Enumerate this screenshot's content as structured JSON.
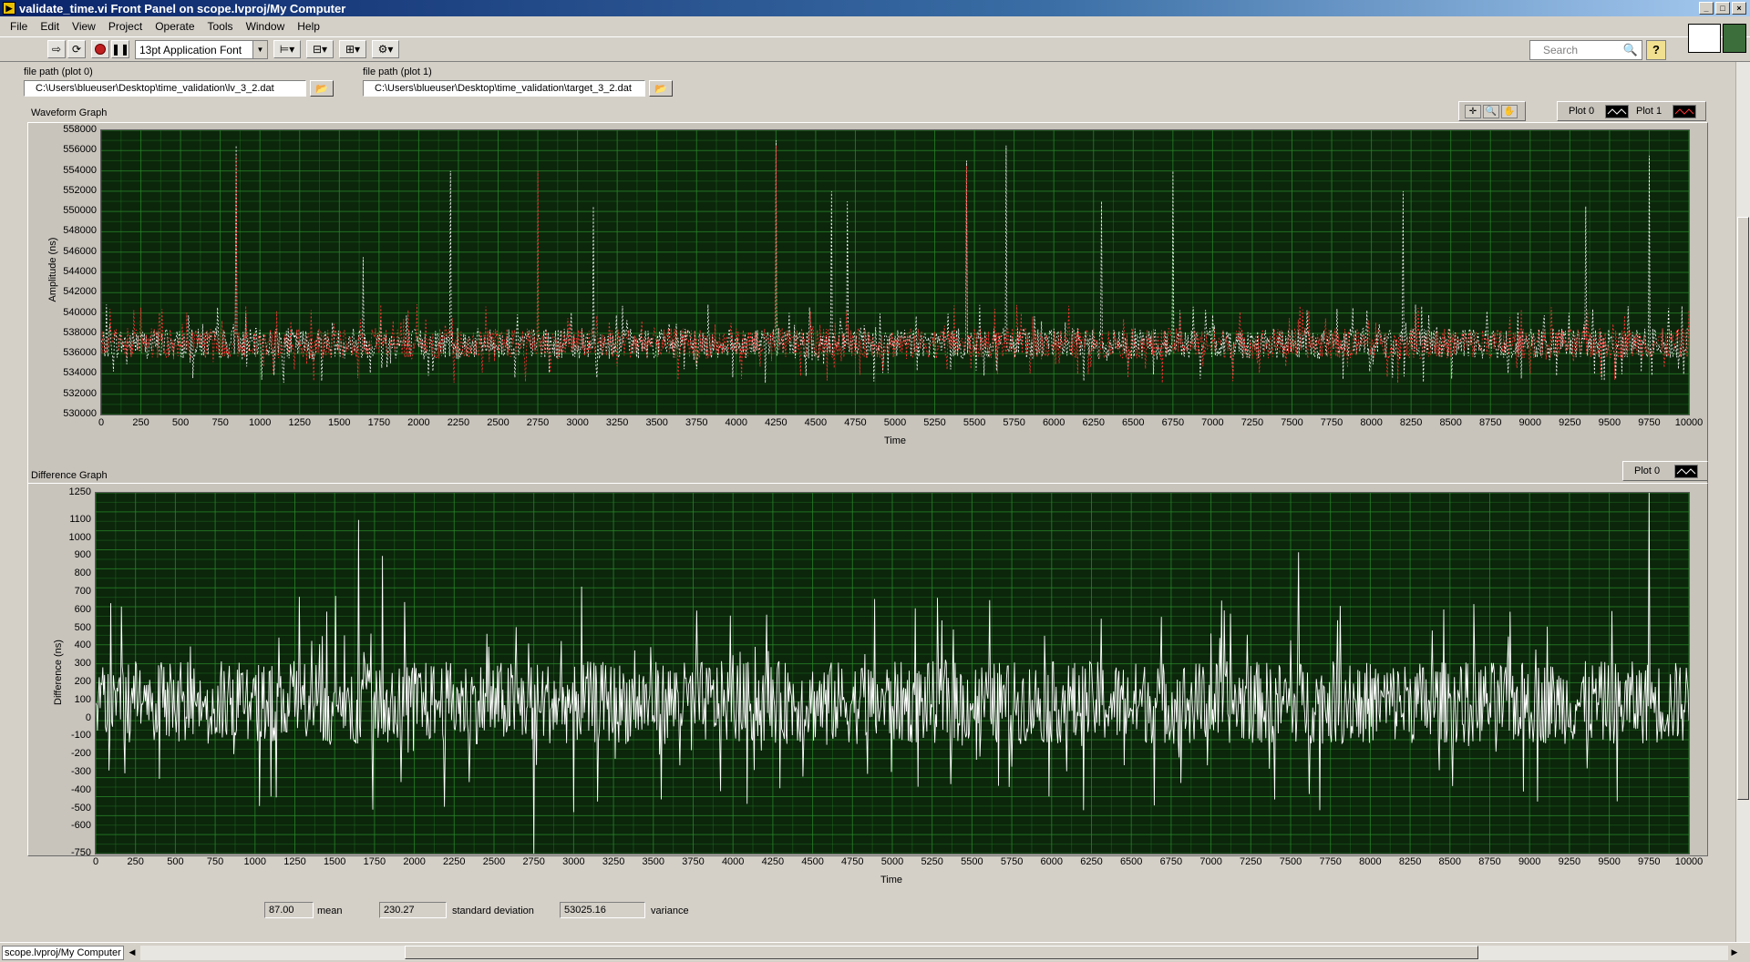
{
  "window": {
    "title": "validate_time.vi Front Panel on scope.lvproj/My Computer"
  },
  "menu": [
    "File",
    "Edit",
    "View",
    "Project",
    "Operate",
    "Tools",
    "Window",
    "Help"
  ],
  "toolbar": {
    "font": "13pt Application Font",
    "search_placeholder": "Search",
    "help_label": "?"
  },
  "file_path_0": {
    "label": "file path (plot 0)",
    "value": "C:\\Users\\blueuser\\Desktop\\time_validation\\lv_3_2.dat"
  },
  "file_path_1": {
    "label": "file path (plot 1)",
    "value": "C:\\Users\\blueuser\\Desktop\\time_validation\\target_3_2.dat"
  },
  "waveform": {
    "label": "Waveform Graph",
    "legend": [
      "Plot 0",
      "Plot 1"
    ],
    "plot0_color": "#ffffff",
    "plot1_color": "#ff3333",
    "grid_color": "#2b8a2b",
    "background": "#0b260b"
  },
  "difference": {
    "label": "Difference Graph",
    "legend": [
      "Plot 0"
    ],
    "plot0_color": "#ffffff"
  },
  "chart_data": [
    {
      "type": "line",
      "title": "Waveform Graph",
      "xlabel": "Time",
      "ylabel": "Amplitude (ns)",
      "xlim": [
        0,
        10000
      ],
      "ylim": [
        530000,
        558000
      ],
      "x_ticks": [
        0,
        250,
        500,
        750,
        1000,
        1250,
        1500,
        1750,
        2000,
        2250,
        2500,
        2750,
        3000,
        3250,
        3500,
        3750,
        4000,
        4250,
        4500,
        4750,
        5000,
        5250,
        5500,
        5750,
        6000,
        6250,
        6500,
        6750,
        7000,
        7250,
        7500,
        7750,
        8000,
        8250,
        8500,
        8750,
        9000,
        9250,
        9500,
        9750,
        10000
      ],
      "y_ticks": [
        530000,
        532000,
        534000,
        536000,
        538000,
        540000,
        542000,
        544000,
        546000,
        548000,
        550000,
        552000,
        554000,
        556000,
        558000
      ],
      "series": [
        {
          "name": "Plot 0",
          "baseline": 537000,
          "spread": 1500,
          "spikes": [
            [
              850,
              556500
            ],
            [
              1650,
              545500
            ],
            [
              2200,
              554000
            ],
            [
              3100,
              550500
            ],
            [
              4250,
              557000
            ],
            [
              4600,
              552000
            ],
            [
              4700,
              551000
            ],
            [
              5450,
              555000
            ],
            [
              5700,
              556500
            ],
            [
              6300,
              551000
            ],
            [
              6750,
              554000
            ],
            [
              8200,
              552000
            ],
            [
              9350,
              550500
            ],
            [
              9750,
              555500
            ]
          ]
        },
        {
          "name": "Plot 1",
          "baseline": 537000,
          "spread": 1500,
          "spikes": [
            [
              2750,
              554000
            ],
            [
              850,
              555500
            ],
            [
              4250,
              556500
            ],
            [
              5450,
              554500
            ]
          ]
        }
      ]
    },
    {
      "type": "line",
      "title": "Difference Graph",
      "xlabel": "Time",
      "ylabel": "Difference (ns)",
      "xlim": [
        0,
        10000
      ],
      "ylim": [
        -750,
        1250
      ],
      "x_ticks": [
        0,
        250,
        500,
        750,
        1000,
        1250,
        1500,
        1750,
        2000,
        2250,
        2500,
        2750,
        3000,
        3250,
        3500,
        3750,
        4000,
        4250,
        4500,
        4750,
        5000,
        5250,
        5500,
        5750,
        6000,
        6250,
        6500,
        6750,
        7000,
        7250,
        7500,
        7750,
        8000,
        8250,
        8500,
        8750,
        9000,
        9250,
        9500,
        9750,
        10000
      ],
      "y_ticks": [
        -750,
        -600,
        -500,
        -400,
        -300,
        -200,
        -100,
        0,
        100,
        200,
        300,
        400,
        500,
        600,
        700,
        800,
        900,
        1000,
        1100,
        1250
      ],
      "series": [
        {
          "name": "Plot 0",
          "baseline": 87,
          "spread": 230,
          "spikes": [
            [
              1650,
              1100
            ],
            [
              1800,
              900
            ],
            [
              3050,
              730
            ],
            [
              7550,
              920
            ],
            [
              9750,
              1250
            ],
            [
              2750,
              -750
            ],
            [
              3000,
              -520
            ],
            [
              7400,
              -450
            ],
            [
              9550,
              -460
            ]
          ]
        }
      ]
    }
  ],
  "stats": {
    "mean": {
      "value": "87.00",
      "label": "mean"
    },
    "std": {
      "value": "230.27",
      "label": "standard deviation"
    },
    "variance": {
      "value": "53025.16",
      "label": "variance"
    }
  },
  "status": {
    "context": "scope.lvproj/My Computer"
  }
}
